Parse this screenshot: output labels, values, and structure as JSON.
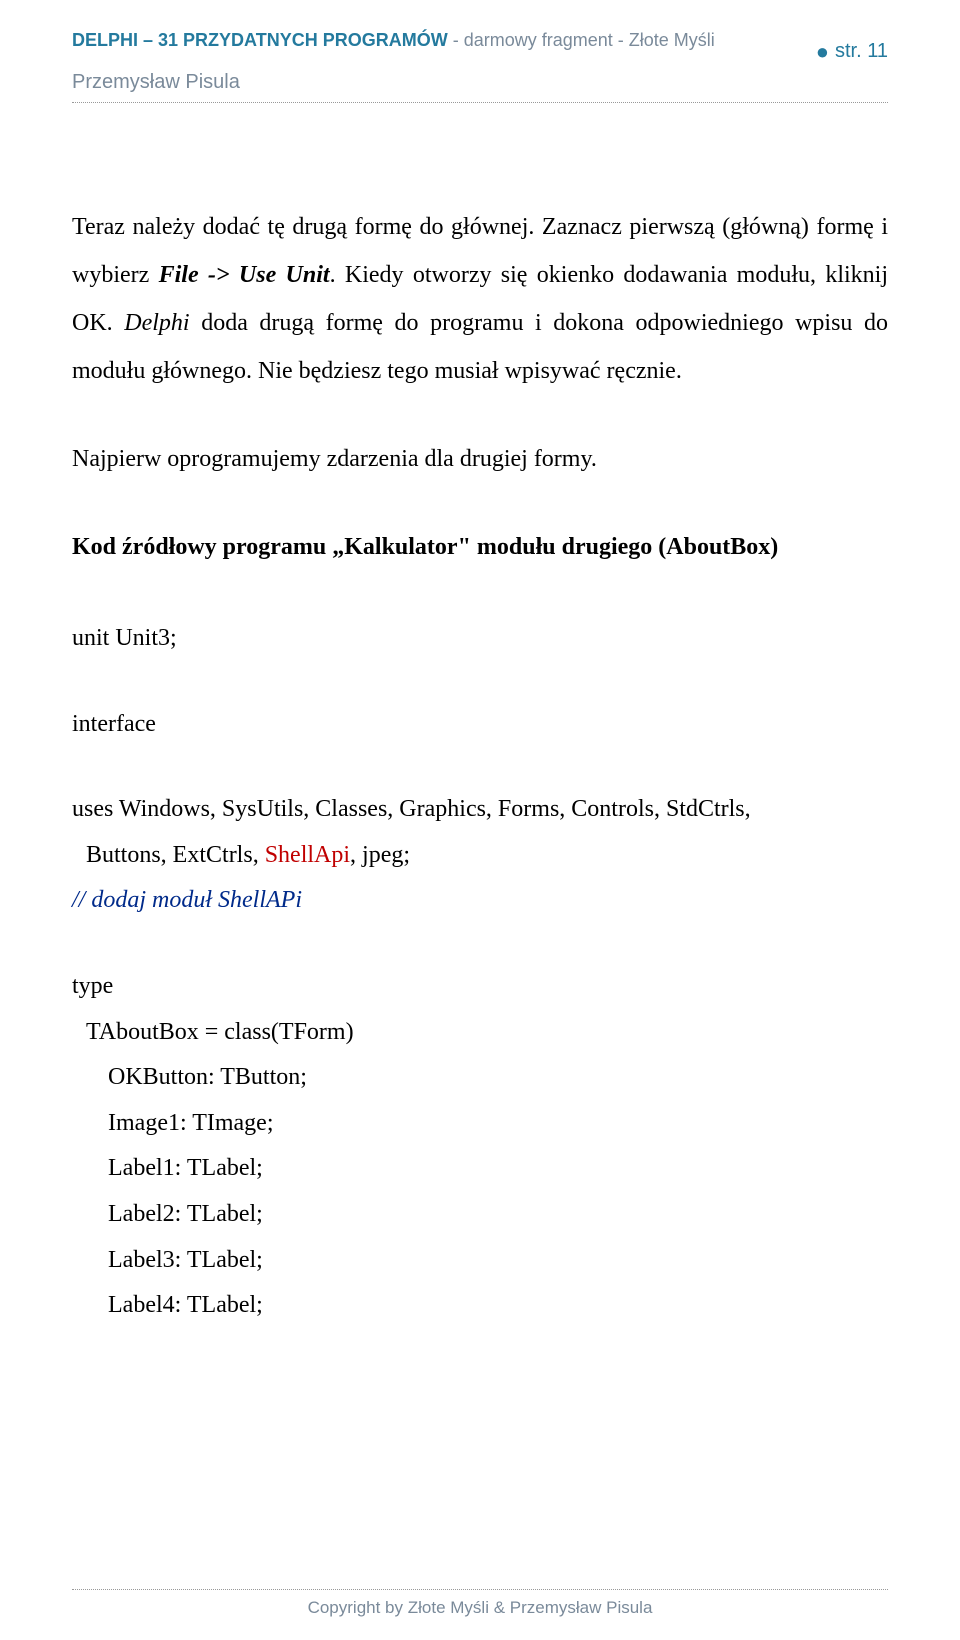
{
  "header": {
    "title_bold": "DELPHI – 31 PRZYDATNYCH PROGRAMÓW",
    "title_rest": " - darmowy fragment - Złote Myśli",
    "page_label": "str. 11",
    "author": "Przemysław Pisula"
  },
  "para1": {
    "t1": "Teraz należy dodać tę drugą formę do głównej. Zaznacz pierwszą (główną) formę i wybierz ",
    "file_use_unit": "File -> Use Unit",
    "t2": ". Kiedy otworzy się okienko dodawania modułu, kliknij OK. ",
    "delphi": "Delphi ",
    "t3": "doda drugą formę do programu i dokona odpowiedniego wpisu do modułu głównego. Nie będziesz tego musiał wpisywać ręcznie."
  },
  "para2": "Najpierw oprogramujemy zdarzenia dla drugiej formy.",
  "heading": "Kod źródłowy programu „Kalkulator\" modułu drugiego (AboutBox)",
  "code": {
    "unit": "unit Unit3;",
    "interface": "interface",
    "uses_pre": "uses Windows, SysUtils, Classes, Graphics, Forms, Controls, StdCtrls,",
    "uses_line2a": "  Buttons, ExtCtrls, ",
    "shellapi": "ShellApi",
    "uses_line2b": ", jpeg;",
    "comment": "// dodaj moduł ShellAPi",
    "type": "type",
    "class": "TAboutBox = class(TForm)",
    "m1": "OKButton: TButton;",
    "m2": "Image1: TImage;",
    "m3": "Label1: TLabel;",
    "m4": "Label2: TLabel;",
    "m5": "Label3: TLabel;",
    "m6": "Label4: TLabel;"
  },
  "footer": "Copyright by Złote Myśli & Przemysław Pisula"
}
